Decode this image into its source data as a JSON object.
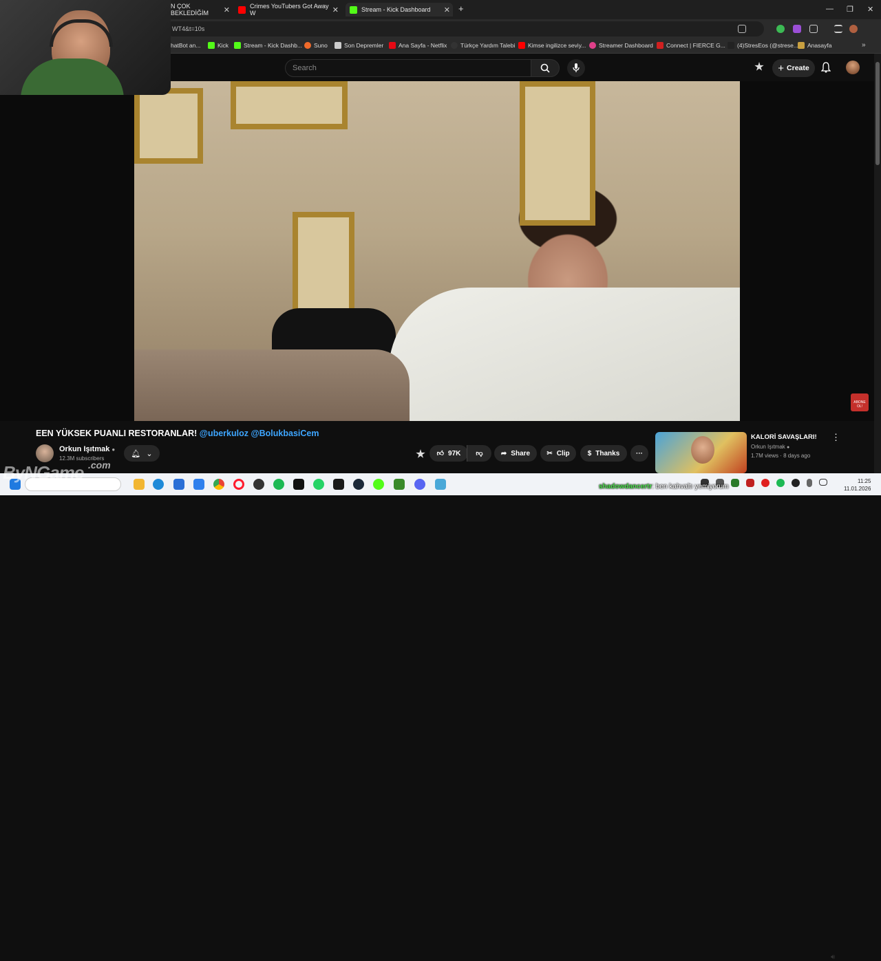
{
  "browser": {
    "tabs": [
      {
        "label": "N ÇOK BEKLEDİĞİM",
        "favicon_color": "#333333"
      },
      {
        "label": "Crimes YouTubers Got Away W",
        "favicon_color": "#ff0000"
      },
      {
        "label": "Stream - Kick Dashboard",
        "favicon_color": "#53fc18"
      }
    ],
    "address": "WT4&t=10s",
    "bookmarks": [
      {
        "label": "hatBot an...",
        "color": "#777777"
      },
      {
        "label": "Kick",
        "color": "#53fc18"
      },
      {
        "label": "Stream - Kick Dashb...",
        "color": "#53fc18"
      },
      {
        "label": "Suno",
        "color": "#f06a2a"
      },
      {
        "label": "Son Depremler",
        "color": "#cccccc"
      },
      {
        "label": "Ana Sayfa - Netflix",
        "color": "#e50914"
      },
      {
        "label": "Türkçe Yardım Talebi",
        "color": "#333333"
      },
      {
        "label": "Kimse ingilizce seviy...",
        "color": "#ff0000"
      },
      {
        "label": "Streamer Dashboard",
        "color": "#e0408a"
      },
      {
        "label": "Connect | FIERCE G...",
        "color": "#d02020"
      },
      {
        "label": "(4)StresEos (@strese...",
        "color": "#222222"
      },
      {
        "label": "Anasayfa",
        "color": "#c8a040"
      }
    ]
  },
  "youtube": {
    "search_placeholder": "Search",
    "create_label": "Create",
    "video": {
      "title_main": "EEN YÜKSEK PUANLI RESTORANLAR! ",
      "title_mentions": "@uberkuloz @BolukbasiCem",
      "channel": "Orkun Işıtmak",
      "subscribers": "12.3M subscribers",
      "likes": "97K",
      "share_label": "Share",
      "clip_label": "Clip",
      "thanks_label": "Thanks"
    },
    "suggested": {
      "title": "KALORİ SAVAŞLARI!",
      "channel": "Orkun Işıtmak",
      "meta": "1.7M views · 8 days ago"
    },
    "badge_text": "ABONE OL!"
  },
  "overlay": {
    "watermark": "ByNGame",
    "watermark_tld": ".com",
    "chat_user": "shadowdancertr",
    "chat_message": ": ben kahvaltı yemiyorum"
  },
  "taskbar": {
    "time": "11:25",
    "date": "11.01.2026"
  }
}
